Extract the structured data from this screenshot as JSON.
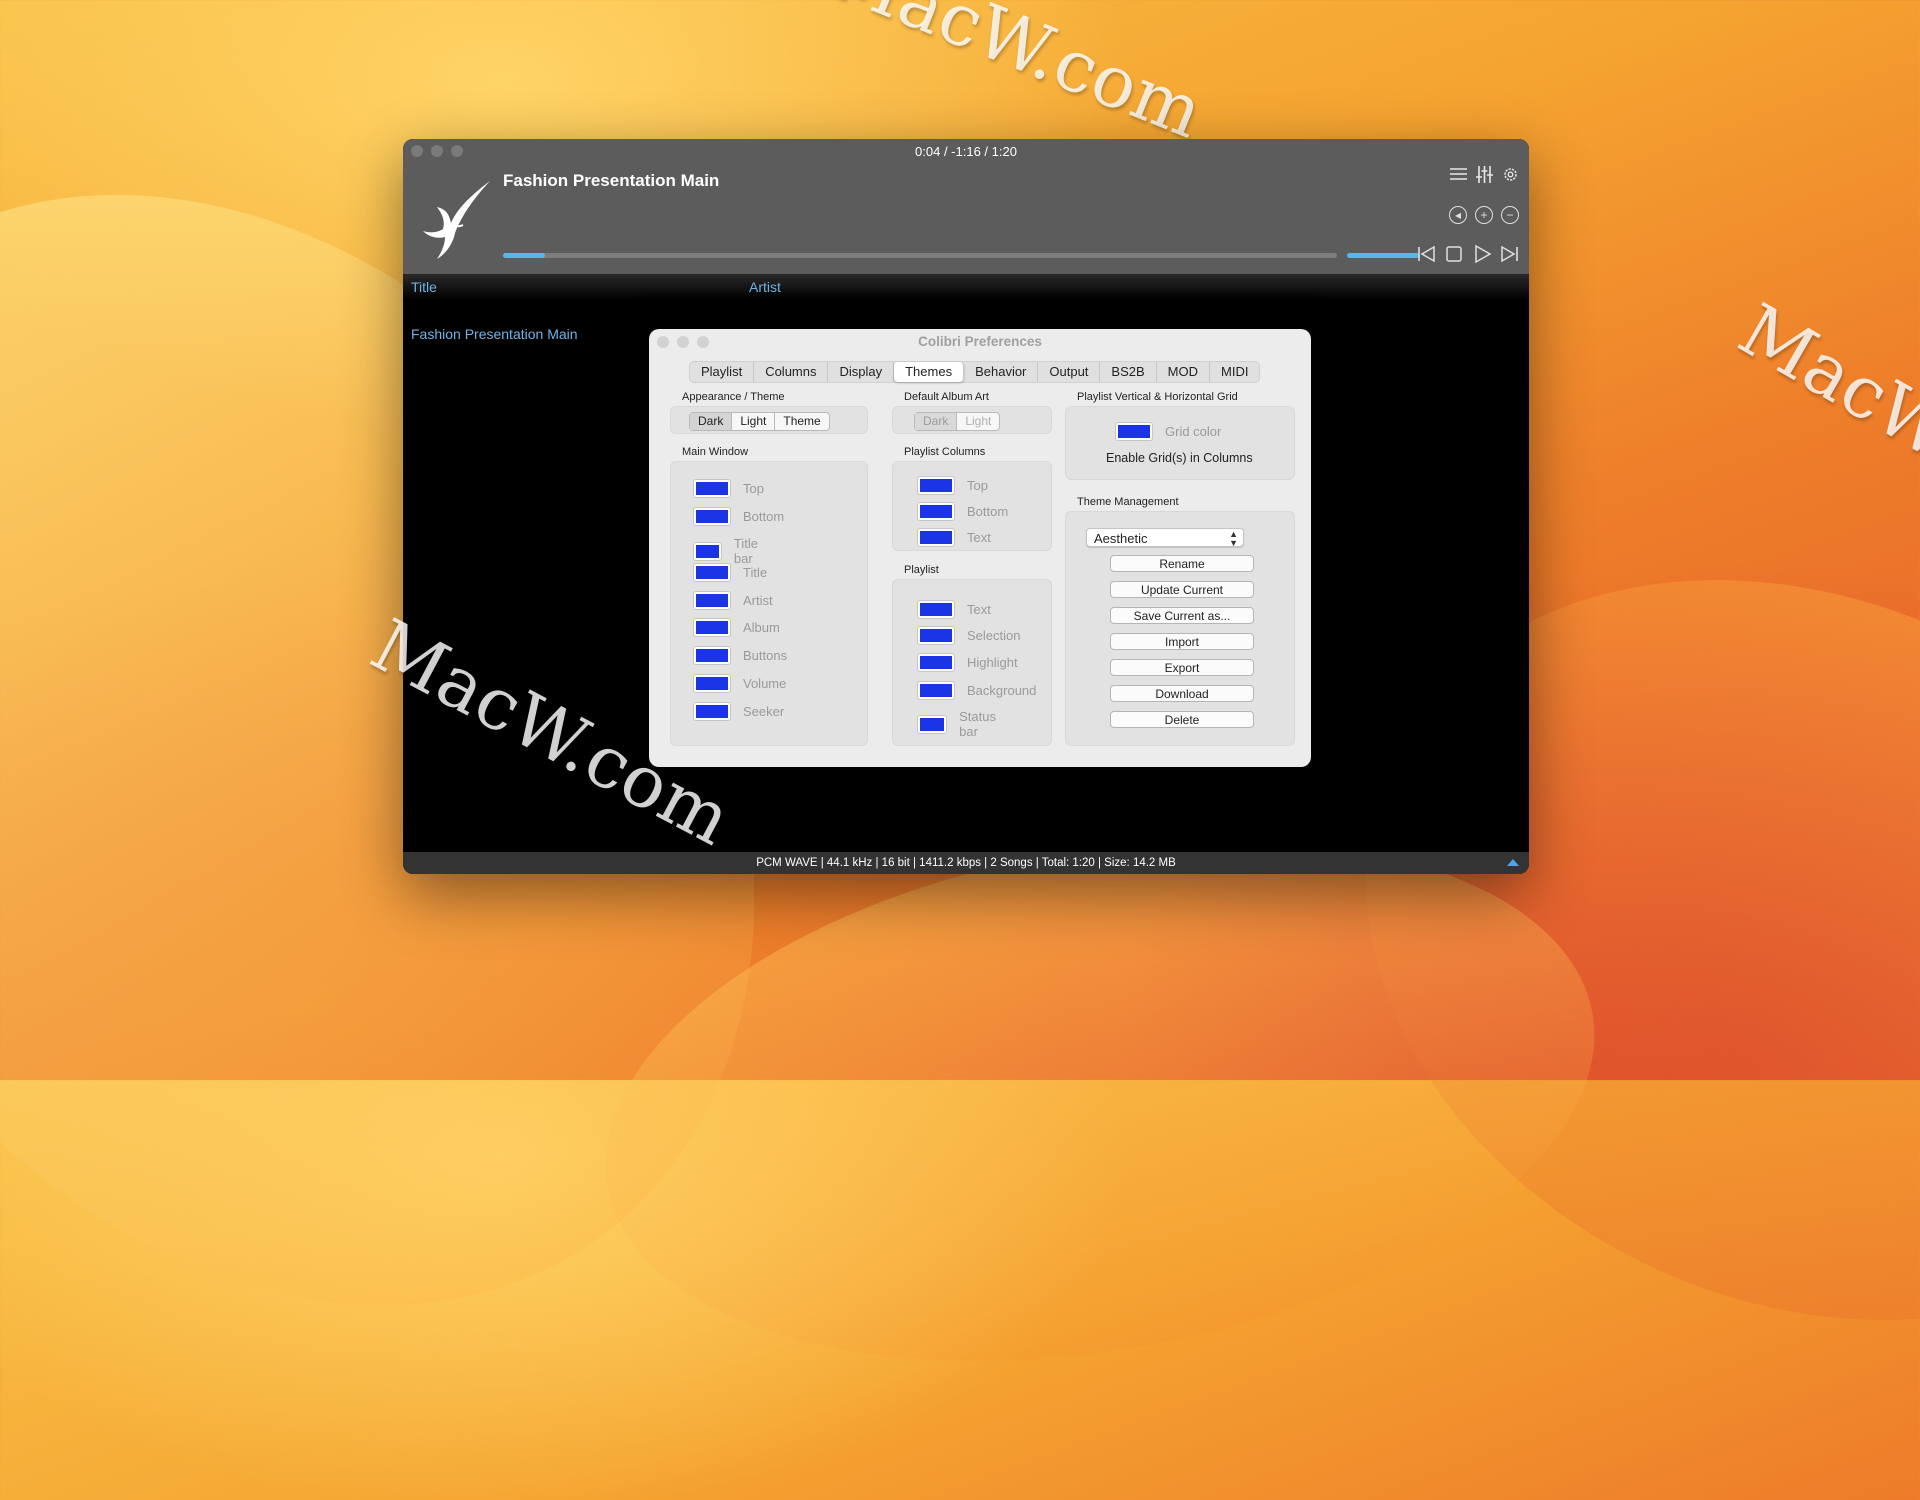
{
  "desktop": {
    "watermarks": [
      "MacW.com",
      "MacW.com",
      "MacW.com"
    ]
  },
  "player": {
    "time_readout": "0:04 / -1:16 / 1:20",
    "track_title": "Fashion Presentation Main",
    "progress_fraction": 0.05,
    "volume_fraction": 1.0,
    "columns": {
      "title": "Title",
      "artist": "Artist"
    },
    "playlist": [
      {
        "title": "Fashion Presentation Main"
      }
    ],
    "status_text": "PCM WAVE | 44.1 kHz | 16 bit | 1411.2 kbps | 2 Songs | Total: 1:20 | Size: 14.2 MB",
    "accent_color": "#5ab4e6",
    "icons": [
      "playlist-icon",
      "equalizer-icon",
      "gear-icon",
      "volume-icon",
      "plus-icon",
      "minus-icon",
      "previous-icon",
      "stop-icon",
      "play-icon",
      "next-icon"
    ]
  },
  "prefs": {
    "title": "Colibri Preferences",
    "tabs": [
      "Playlist",
      "Columns",
      "Display",
      "Themes",
      "Behavior",
      "Output",
      "BS2B",
      "MOD",
      "MIDI"
    ],
    "active_tab": "Themes",
    "appearance": {
      "label": "Appearance / Theme",
      "options": [
        "Dark",
        "Light",
        "Theme"
      ],
      "selected": "Dark"
    },
    "album_art": {
      "label": "Default Album Art",
      "options": [
        "Dark",
        "Light"
      ],
      "selected": "Dark"
    },
    "grid": {
      "label": "Playlist Vertical & Horizontal Grid",
      "color_label": "Grid color",
      "enable_label": "Enable Grid(s) in Columns"
    },
    "main_window": {
      "label": "Main Window",
      "items": [
        "Top",
        "Bottom",
        "Title bar",
        "Title",
        "Artist",
        "Album",
        "Buttons",
        "Volume",
        "Seeker"
      ]
    },
    "playlist_columns": {
      "label": "Playlist Columns",
      "items": [
        "Top",
        "Bottom",
        "Text"
      ]
    },
    "playlist": {
      "label": "Playlist",
      "items": [
        "Text",
        "Selection",
        "Highlight",
        "Background",
        "Status bar"
      ]
    },
    "theme_management": {
      "label": "Theme Management",
      "selected_theme": "Aesthetic",
      "buttons": [
        "Rename",
        "Update Current",
        "Save Current as...",
        "Import",
        "Export",
        "Download",
        "Delete"
      ]
    },
    "swatch_color": "#1a34e6"
  }
}
